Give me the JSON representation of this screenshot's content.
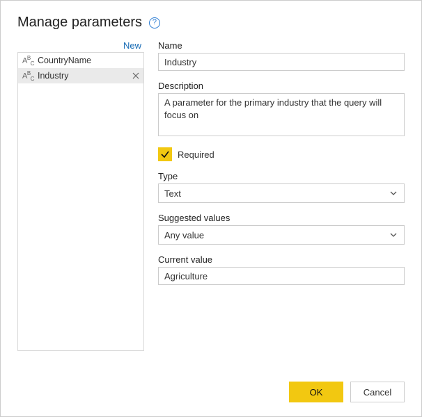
{
  "title": "Manage parameters",
  "newLink": "New",
  "parameters": [
    {
      "label": "CountryName"
    },
    {
      "label": "Industry"
    }
  ],
  "form": {
    "nameLabel": "Name",
    "name": "Industry",
    "descriptionLabel": "Description",
    "description": "A parameter for the primary industry that the query will focus on",
    "requiredLabel": "Required",
    "typeLabel": "Type",
    "type": "Text",
    "suggestedLabel": "Suggested values",
    "suggested": "Any value",
    "currentLabel": "Current value",
    "current": "Agriculture"
  },
  "buttons": {
    "ok": "OK",
    "cancel": "Cancel"
  }
}
